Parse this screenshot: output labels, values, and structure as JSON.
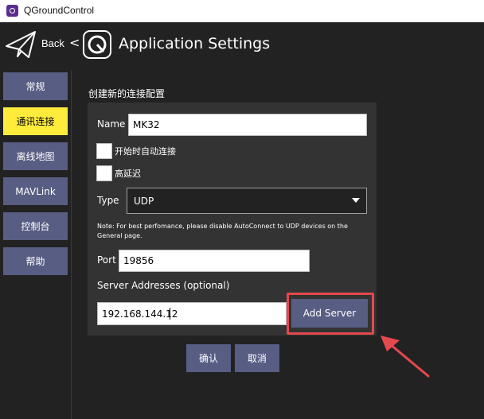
{
  "window": {
    "title": "QGroundControl"
  },
  "header": {
    "back_label": "Back",
    "chevron": "<",
    "title": "Application Settings"
  },
  "sidebar": {
    "items": [
      {
        "label": "常规",
        "active": false
      },
      {
        "label": "通讯连接",
        "active": true
      },
      {
        "label": "离线地图",
        "active": false
      },
      {
        "label": "MAVLink",
        "active": false
      },
      {
        "label": "控制台",
        "active": false
      },
      {
        "label": "帮助",
        "active": false
      }
    ]
  },
  "form": {
    "group_title": "创建新的连接配置",
    "name_label": "Name",
    "name_value": "MK32",
    "autoconnect_label": "开始时自动连接",
    "high_latency_label": "高延迟",
    "type_label": "Type",
    "type_value": "UDP",
    "note": "Note: For best perfomance, please disable AutoConnect to UDP devices on the General page.",
    "port_label": "Port",
    "port_value": "19856",
    "server_addresses_label": "Server Addresses (optional)",
    "server_value": "192.168.144.12",
    "add_server_label": "Add Server"
  },
  "actions": {
    "ok_label": "确认",
    "cancel_label": "取消"
  },
  "colors": {
    "accent_active": "#ffeb3b",
    "button": "#585d83",
    "highlight": "#e5484d",
    "background": "#222222",
    "panel": "#333333"
  },
  "icons": {
    "back": "paper-plane-icon",
    "logo": "qgc-logo-icon",
    "dropdown": "caret-down-icon"
  }
}
